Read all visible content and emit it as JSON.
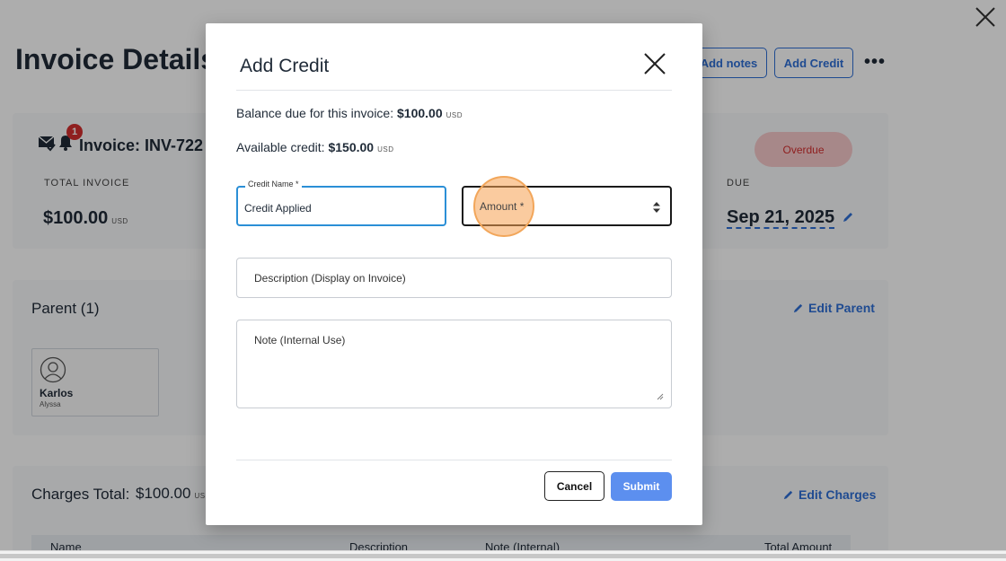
{
  "colors": {
    "accent": "#2f6fd6",
    "overdue_bg": "#f6c9cb",
    "overdue_text": "#d32f2f",
    "submit_bg": "#5c8fef",
    "focus_border": "#2b8fd6",
    "highlight": "#f2a65a"
  },
  "page": {
    "title": "Invoice Details",
    "header_buttons": {
      "add_notes": "Add notes",
      "add_credit": "Add Credit"
    },
    "more_icon": "•••",
    "close_icon": "close-icon"
  },
  "invoice": {
    "notification_count": "1",
    "id": "Invoice: INV-722",
    "total_label": "TOTAL INVOICE",
    "total_value": "$100.00",
    "currency": "USD",
    "status": "Overdue",
    "due_label": "DUE",
    "due_date": "Sep 21, 2025"
  },
  "parent": {
    "title": "Parent (1)",
    "edit_label": "Edit Parent",
    "card": {
      "name": "Karlos",
      "sub": "Alyssa"
    }
  },
  "charges": {
    "title": "Charges Total:",
    "amount": "$100.00",
    "currency_partial": "US",
    "edit_label": "Edit Charges",
    "columns": [
      "Name",
      "Description",
      "Note (Internal)",
      "Total Amount"
    ]
  },
  "modal": {
    "title": "Add Credit",
    "balance_label": "Balance due for this invoice:",
    "balance_value": "$100.00",
    "available_label": "Available credit:",
    "available_value": "$150.00",
    "currency": "USD",
    "credit_name_label": "Credit Name *",
    "credit_name_value": "Credit Applied",
    "amount_placeholder": "Amount *",
    "description_placeholder": "Description (Display on Invoice)",
    "note_placeholder": "Note (Internal Use)",
    "cancel_label": "Cancel",
    "submit_label": "Submit"
  }
}
